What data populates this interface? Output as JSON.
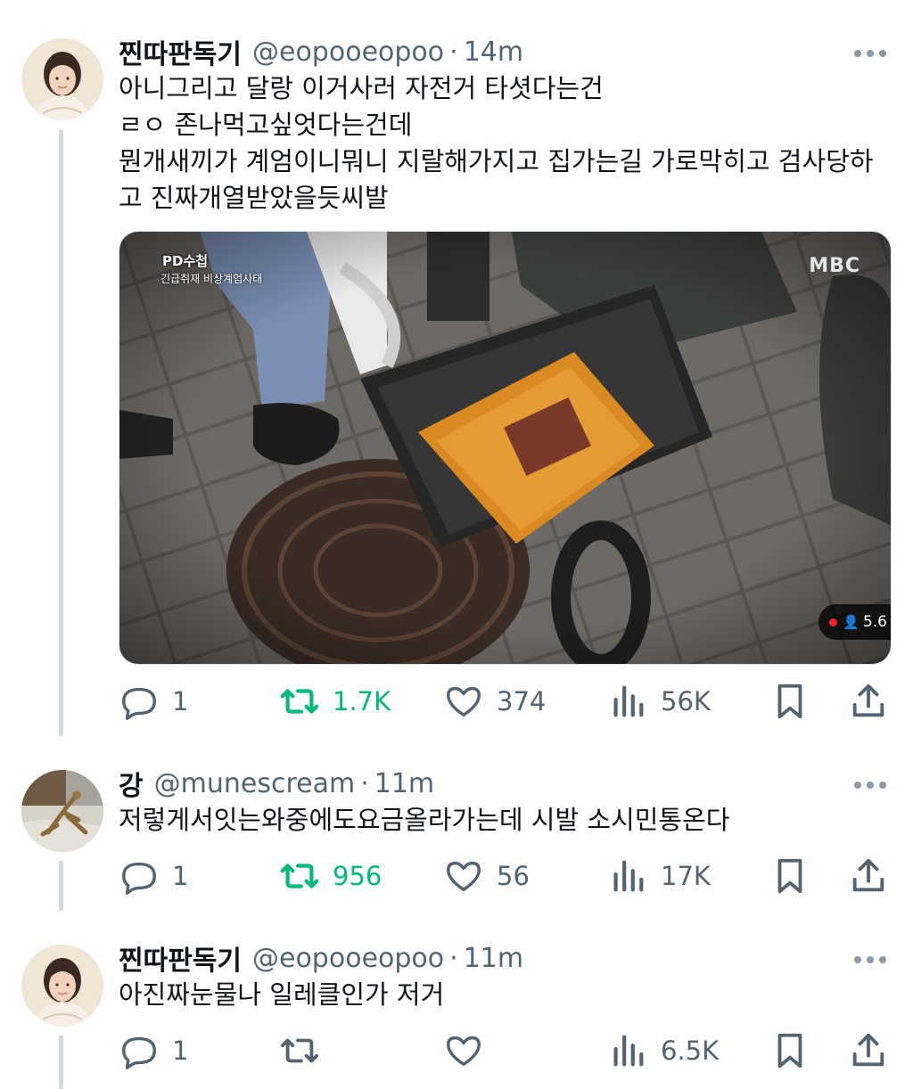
{
  "tweets": [
    {
      "name": "찐따판독기",
      "handle": "@eopooeopoo",
      "time": "14m",
      "lines": [
        "아니그리고 달랑 이거사러 자전거 타셧다는건",
        "ㄹㅇ 존나먹고싶엇다는건데",
        "뭔개새끼가 계엄이니뭐니 지랄해가지고 집가는길 가로막히고 검사당하",
        "고 진짜개열받았을듯씨발"
      ],
      "media": {
        "program_logo": "PD수첩",
        "caption": "긴급취재 비상계엄사태",
        "broadcaster": "MBC",
        "live_viewers": "5.6"
      },
      "replies": "1",
      "retweets": "1.7K",
      "likes": "374",
      "views": "56K",
      "retweeted": true
    },
    {
      "name": "강",
      "handle": "@munescream",
      "time": "11m",
      "lines": [
        "저렇게서잇는와중에도요금올라가는데 시발 소시민통온다"
      ],
      "replies": "1",
      "retweets": "956",
      "likes": "56",
      "views": "17K",
      "retweeted": true
    },
    {
      "name": "찐따판독기",
      "handle": "@eopooeopoo",
      "time": "11m",
      "lines": [
        "아진짜눈물나 일레클인가 저거"
      ],
      "replies": "1",
      "retweets": "",
      "likes": "",
      "views": "6.5K",
      "retweeted": false
    }
  ],
  "colors": {
    "text": "#0f1419",
    "secondary": "#536471",
    "retweet_green": "#00ba7c",
    "thread_line": "#cfd9de"
  },
  "icons": [
    "reply-icon",
    "retweet-icon",
    "like-icon",
    "views-icon",
    "bookmark-icon",
    "share-icon",
    "more-icon"
  ]
}
